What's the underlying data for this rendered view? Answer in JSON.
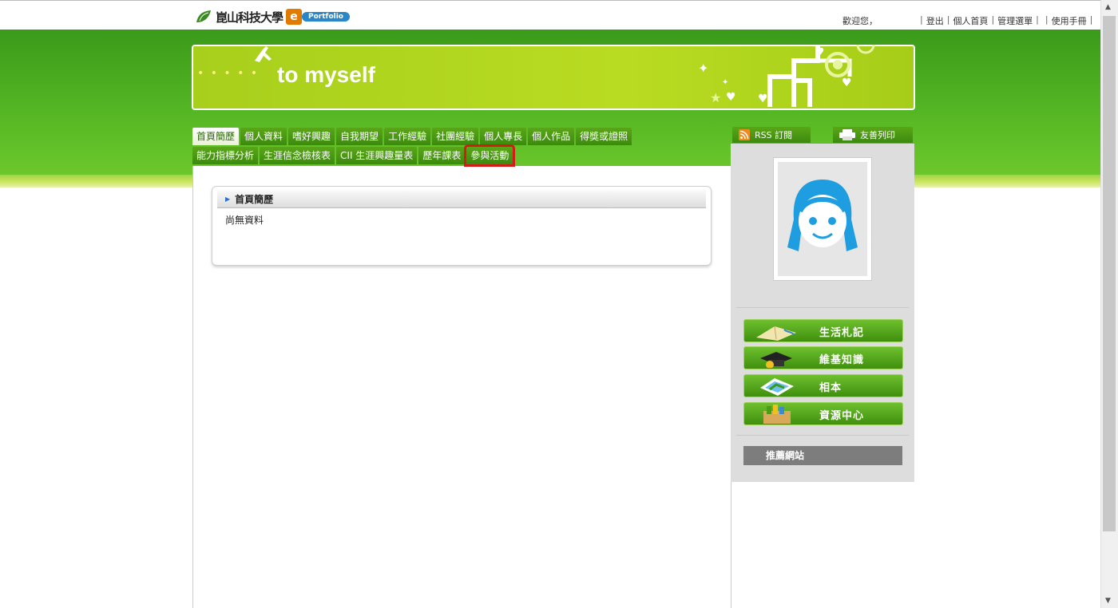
{
  "header": {
    "welcome": "歡迎您，",
    "links": [
      "登出",
      "個人首頁",
      "管理選單",
      "使用手冊"
    ],
    "logo_pill": "Portfolio",
    "logo_e": "e",
    "logo_text": "崑山科技大學"
  },
  "banner": {
    "title": "to myself"
  },
  "tabs": {
    "row1": [
      "首頁簡歷",
      "個人資料",
      "嗜好興趣",
      "自我期望",
      "工作經驗",
      "社團經驗",
      "個人專長",
      "個人作品",
      "得獎或證照"
    ],
    "row2": [
      "能力指標分析",
      "生涯信念檢核表",
      "CII 生涯興趣量表",
      "歷年課表",
      "參與活動"
    ]
  },
  "panel": {
    "title": "首頁簡歷",
    "body": "尚無資料"
  },
  "sidebar": {
    "rss": "RSS 訂閱",
    "print": "友善列印",
    "nav": [
      "生活札記",
      "維基知識",
      "相本",
      "資源中心"
    ],
    "links_title": "推薦網站"
  },
  "colors": {
    "green": "#4a9e16",
    "highlight": "#d61919"
  }
}
